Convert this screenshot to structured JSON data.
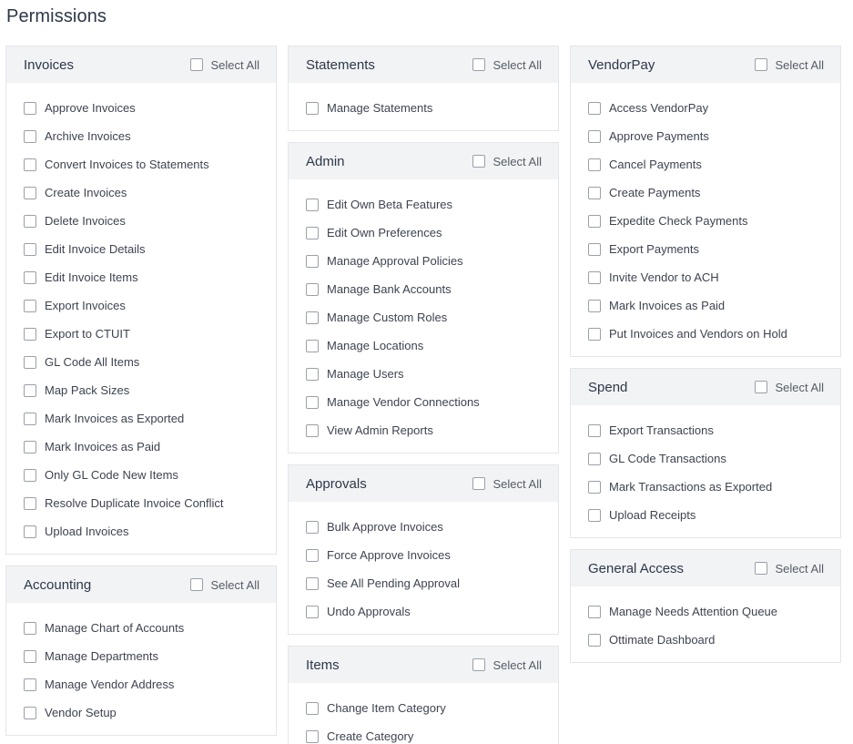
{
  "page": {
    "title": "Permissions"
  },
  "select_all_label": "Select All",
  "columns": [
    [
      {
        "title": "Invoices",
        "items": [
          "Approve Invoices",
          "Archive Invoices",
          "Convert Invoices to Statements",
          "Create Invoices",
          "Delete Invoices",
          "Edit Invoice Details",
          "Edit Invoice Items",
          "Export Invoices",
          "Export to CTUIT",
          "GL Code All Items",
          "Map Pack Sizes",
          "Mark Invoices as Exported",
          "Mark Invoices as Paid",
          "Only GL Code New Items",
          "Resolve Duplicate Invoice Conflict",
          "Upload Invoices"
        ]
      },
      {
        "title": "Accounting",
        "items": [
          "Manage Chart of Accounts",
          "Manage Departments",
          "Manage Vendor Address",
          "Vendor Setup"
        ]
      }
    ],
    [
      {
        "title": "Statements",
        "items": [
          "Manage Statements"
        ]
      },
      {
        "title": "Admin",
        "items": [
          "Edit Own Beta Features",
          "Edit Own Preferences",
          "Manage Approval Policies",
          "Manage Bank Accounts",
          "Manage Custom Roles",
          "Manage Locations",
          "Manage Users",
          "Manage Vendor Connections",
          "View Admin Reports"
        ]
      },
      {
        "title": "Approvals",
        "items": [
          "Bulk Approve Invoices",
          "Force Approve Invoices",
          "See All Pending Approval",
          "Undo Approvals"
        ]
      },
      {
        "title": "Items",
        "items": [
          "Change Item Category",
          "Create Category"
        ]
      }
    ],
    [
      {
        "title": "VendorPay",
        "items": [
          "Access VendorPay",
          "Approve Payments",
          "Cancel Payments",
          "Create Payments",
          "Expedite Check Payments",
          "Export Payments",
          "Invite Vendor to ACH",
          "Mark Invoices as Paid",
          "Put Invoices and Vendors on Hold"
        ]
      },
      {
        "title": "Spend",
        "items": [
          "Export Transactions",
          "GL Code Transactions",
          "Mark Transactions as Exported",
          "Upload Receipts"
        ]
      },
      {
        "title": "General Access",
        "items": [
          "Manage Needs Attention Queue",
          "Ottimate Dashboard"
        ]
      }
    ]
  ]
}
